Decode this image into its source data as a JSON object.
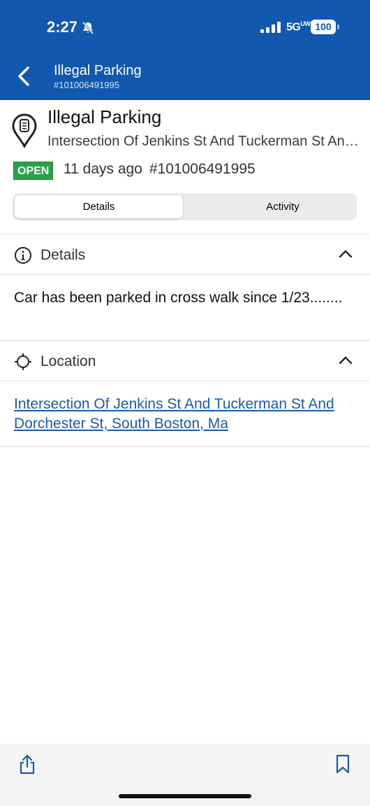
{
  "status_bar": {
    "time": "2:27",
    "network": "5G",
    "network_sub": "UW",
    "battery": "100",
    "silent_icon": "bell-slash-icon"
  },
  "header": {
    "title": "Illegal Parking",
    "subtitle": "#101006491995",
    "back_icon": "chevron-left-icon",
    "color": "#1158ae"
  },
  "issue": {
    "icon": "parking-meter-pin-icon",
    "title": "Illegal Parking",
    "address": "Intersection Of Jenkins St And Tuckerman St And Dorchester St, South Boston, Ma",
    "status": "OPEN",
    "status_color": "#2ca14a",
    "age": "11 days ago",
    "id": "#101006491995"
  },
  "tabs": [
    {
      "label": "Details",
      "active": true
    },
    {
      "label": "Activity",
      "active": false
    }
  ],
  "sections": {
    "details": {
      "label": "Details",
      "icon": "info-icon",
      "expanded": true,
      "text": "Car has been parked in cross walk since 1/23........"
    },
    "location": {
      "label": "Location",
      "icon": "crosshair-icon",
      "expanded": true,
      "link": "Intersection Of Jenkins St And Tuckerman St And Dorchester St, South Boston, Ma"
    }
  },
  "bottom_bar": {
    "share_icon": "share-icon",
    "bookmark_icon": "bookmark-icon"
  }
}
